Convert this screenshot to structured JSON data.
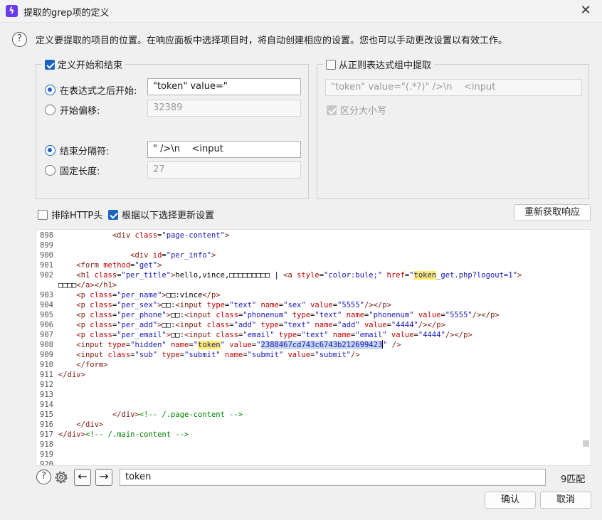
{
  "window": {
    "title": "提取的grep项的定义",
    "close_glyph": "✕"
  },
  "description": "定义要提取的项目的位置。在响应面板中选择项目时，将自动创建相应的设置。您也可以手动更改设置以有效工作。",
  "define_group": {
    "label": "定义开始和结束",
    "checked": true,
    "after_expression": {
      "label": "在表达式之后开始:",
      "value": "\"token\" value=\"",
      "selected": true
    },
    "start_offset": {
      "label": "开始偏移:",
      "value": "32389",
      "selected": false
    },
    "end_delimiter": {
      "label": "结束分隔符:",
      "value": "\" />\\n    <input",
      "selected": true
    },
    "fixed_length": {
      "label": "固定长度:",
      "value": "27",
      "selected": false
    }
  },
  "regex_group": {
    "label": "从正则表达式组中提取",
    "checked": false,
    "value": "\"token\" value=\"(.*?)\" />\\n    <input",
    "case_sensitive_label": "区分大小写",
    "case_sensitive_checked": true
  },
  "options": {
    "exclude_http_headers_label": "排除HTTP头",
    "exclude_http_headers_checked": false,
    "update_from_selection_label": "根据以下选择更新设置",
    "update_from_selection_checked": true,
    "refetch_button": "重新获取响应"
  },
  "code_lines": [
    {
      "n": "898",
      "code": "            <div class=\"page-content\">"
    },
    {
      "n": "899",
      "code": ""
    },
    {
      "n": "900",
      "code": "                <div id=\"per_info\">"
    },
    {
      "n": "901",
      "code": "    <form method=\"get\">"
    },
    {
      "n": "902",
      "code": "    <h1 class=\"per_title\">hello,vince,□□□□□□□□□ | <a style=\"color:bule;\" href=\"token_get.php?logout=1\">"
    },
    {
      "n": "",
      "code": "□□□□</a></h1>"
    },
    {
      "n": "903",
      "code": "    <p class=\"per_name\">□□:vince</p>"
    },
    {
      "n": "904",
      "code": "    <p class=\"per_sex\">□□:<input type=\"text\" name=\"sex\" value=\"5555\"/></p>"
    },
    {
      "n": "905",
      "code": "    <p class=\"per_phone\">□□:<input class=\"phonenum\" type=\"text\" name=\"phonenum\" value=\"5555\"/></p>"
    },
    {
      "n": "906",
      "code": "    <p class=\"per_add\">□□:<input class=\"add\" type=\"text\" name=\"add\" value=\"4444\"/></p>"
    },
    {
      "n": "907",
      "code": "    <p class=\"per_email\">□□:<input class=\"email\" type=\"text\" name=\"email\" value=\"4444\"/></p>"
    },
    {
      "n": "908",
      "code": "    <input type=\"hidden\" name=\"token\" value=\"2388467cd743c6743b212699423\" />"
    },
    {
      "n": "909",
      "code": "    <input class=\"sub\" type=\"submit\" name=\"submit\" value=\"submit\"/>"
    },
    {
      "n": "910",
      "code": "    </form>"
    },
    {
      "n": "911",
      "code": "</div>"
    },
    {
      "n": "912",
      "code": ""
    },
    {
      "n": "913",
      "code": ""
    },
    {
      "n": "914",
      "code": ""
    },
    {
      "n": "915",
      "code": "            </div><!-- /.page-content -->"
    },
    {
      "n": "916",
      "code": "    </div>"
    },
    {
      "n": "917",
      "code": "</div><!-- /.main-content -->"
    },
    {
      "n": "918",
      "code": ""
    },
    {
      "n": "919",
      "code": ""
    },
    {
      "n": "920",
      "code": ""
    }
  ],
  "search": {
    "value": "token",
    "match_count": "9匹配",
    "prev_glyph": "←",
    "next_glyph": "→"
  },
  "footer": {
    "ok_button": "确认",
    "cancel_button": "取消"
  },
  "colors": {
    "accent": "#1964c4",
    "highlight": "#ffef5c",
    "selection": "#c7d7f0",
    "tag": "#7d1a0f",
    "attribute": "#c00000",
    "value": "#1818b8",
    "comment": "#008000"
  }
}
